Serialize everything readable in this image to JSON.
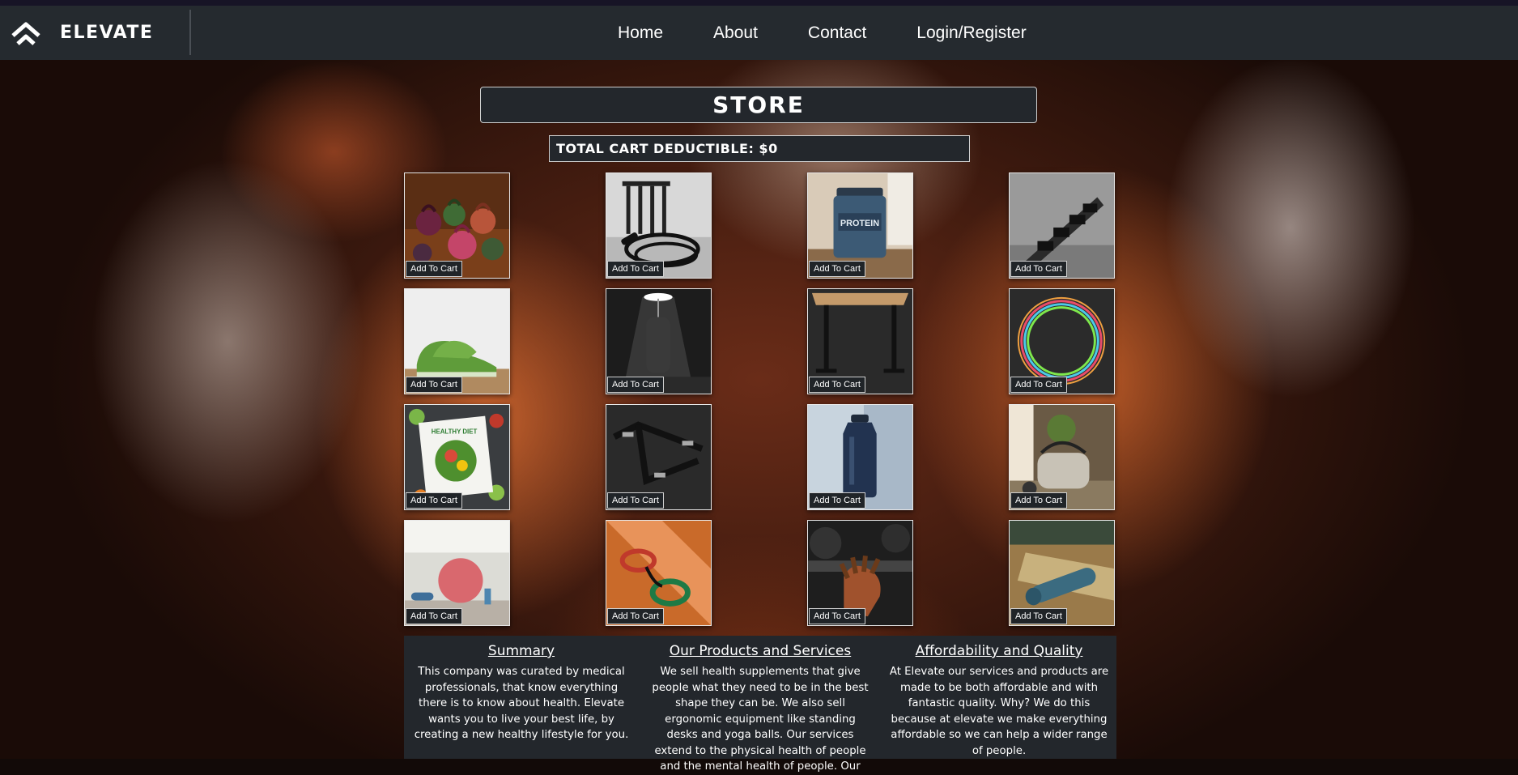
{
  "nav": {
    "brand": "ELEVATE",
    "links": [
      "Home",
      "About",
      "Contact",
      "Login/Register"
    ]
  },
  "store": {
    "title": "STORE",
    "cart_total": "TOTAL CART DEDUCTIBLE: $0",
    "add_label": "Add To Cart",
    "products": [
      {
        "icon": "kettlebells-icon"
      },
      {
        "icon": "jump-rope-icon"
      },
      {
        "icon": "protein-tub-icon"
      },
      {
        "icon": "dumbbell-rack-icon"
      },
      {
        "icon": "sneakers-icon"
      },
      {
        "icon": "punching-bag-icon"
      },
      {
        "icon": "standing-desk-icon"
      },
      {
        "icon": "hula-hoops-icon"
      },
      {
        "icon": "diet-book-icon"
      },
      {
        "icon": "pullup-bar-icon"
      },
      {
        "icon": "water-bottle-icon"
      },
      {
        "icon": "gym-bag-icon"
      },
      {
        "icon": "yoga-ball-icon"
      },
      {
        "icon": "resistance-bands-icon"
      },
      {
        "icon": "gym-gloves-icon"
      },
      {
        "icon": "yoga-mat-icon"
      }
    ]
  },
  "protein_label": "PROTEIN",
  "diet_label": "HEALTHY DIET",
  "footer": {
    "summary_title": "Summary",
    "summary_text": "This company was curated by medical professionals, that know everything there is to know about health. Elevate wants you to live your best life, by creating a new healthy lifestyle for you.",
    "products_title": "Our Products and Services",
    "products_text": "We sell health supplements that give people what they need to be in the best shape they can be. We also sell ergonomic equipment like standing desks and yoga balls. Our services extend to the physical health of people and the mental health of people. Our",
    "quality_title": "Affordability and Quality",
    "quality_text": "At Elevate our services and products are made to be both affordable and with fantastic quality. Why? We do this because at elevate we make everything affordable so we can help a wider range of people."
  }
}
